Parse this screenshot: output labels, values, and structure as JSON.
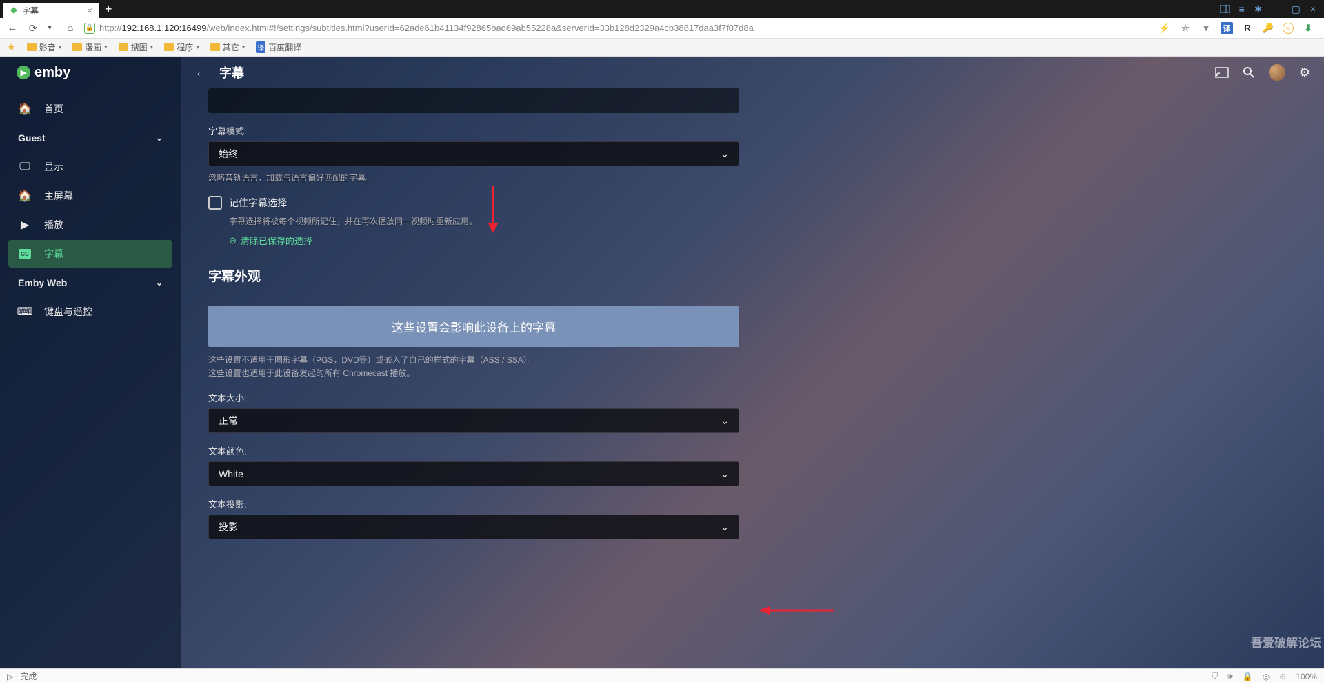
{
  "browser": {
    "tab_title": "字幕",
    "url_prefix": "http://",
    "url_host": "192.168.1.120:16499",
    "url_path": "/web/index.html#!/settings/subtitles.html?userId=62ade61b41134f92865bad69ab55228a&serverId=33b128d2329a4cb38817daa3f7f07d8a",
    "ext_r": "R",
    "ext_trans": "译"
  },
  "bookmarks": {
    "items": [
      "影音",
      "漫画",
      "搜图",
      "程序",
      "其它"
    ],
    "translate": "百度翻译"
  },
  "logo": "emby",
  "nav": {
    "home": "首页",
    "section_guest": "Guest",
    "display": "显示",
    "homescreen": "主屏幕",
    "playback": "播放",
    "subtitles": "字幕",
    "section_web": "Emby Web",
    "keyboard": "键盘与遥控"
  },
  "page": {
    "title": "字幕",
    "mode_label": "字幕模式:",
    "mode_value": "始终",
    "mode_helper": "忽略音轨语言，加载与语言偏好匹配的字幕。",
    "remember_label": "记住字幕选择",
    "remember_helper": "字幕选择将被每个视频所记住，并在再次播放同一视频时重新应用。",
    "clear_link": "清除已保存的选择",
    "appearance_title": "字幕外观",
    "banner": "这些设置会影响此设备上的字幕",
    "banner_note1": "这些设置不适用于图形字幕（PGS，DVD等）或嵌入了自己的样式的字幕（ASS / SSA）。",
    "banner_note2": "这些设置也适用于此设备发起的所有 Chromecast 播放。",
    "size_label": "文本大小:",
    "size_value": "正常",
    "color_label": "文本颜色:",
    "color_value": "White",
    "shadow_label": "文本投影:",
    "shadow_value": "投影"
  },
  "status": {
    "done": "完成",
    "zoom": "100%"
  },
  "watermark": "吾爱破解论坛"
}
